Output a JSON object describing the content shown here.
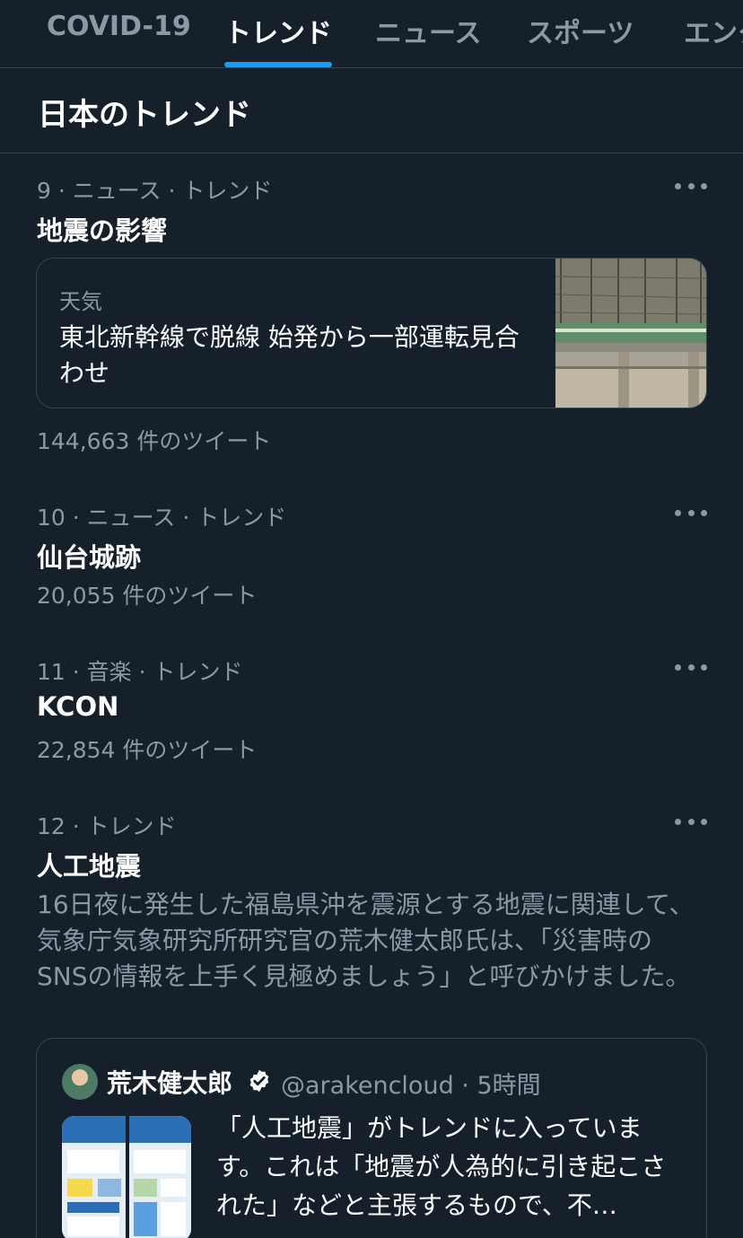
{
  "tabs": [
    {
      "label": "COVID-19",
      "active": false
    },
    {
      "label": "トレンド",
      "active": true
    },
    {
      "label": "ニュース",
      "active": false
    },
    {
      "label": "スポーツ",
      "active": false
    },
    {
      "label": "エンタ",
      "active": false
    }
  ],
  "section_title": "日本のトレンド",
  "trends": [
    {
      "meta": "9 · ニュース · トレンド",
      "topic": "地震の影響",
      "card": {
        "category": "天気",
        "headline": "東北新幹線で脱線 始発から一部運転見合わせ",
        "thumbnail": "bullet-train-on-viaduct-photo"
      },
      "count": "144,663 件のツイート"
    },
    {
      "meta": "10 · ニュース · トレンド",
      "topic": "仙台城跡",
      "count": "20,055 件のツイート"
    },
    {
      "meta": "11 · 音楽 · トレンド",
      "topic": "KCON",
      "count": "22,854 件のツイート"
    },
    {
      "meta": "12 · トレンド",
      "topic": "人工地震",
      "description": "16日夜に発生した福島県沖を震源とする地震に関連して、気象庁気象研究所研究官の荒木健太郎氏は、「災害時のSNSの情報を上手く見極めましょう」と呼びかけました。",
      "tweet": {
        "author": "荒木健太郎",
        "verified": true,
        "handle": "@arakencloud · 5時間",
        "text": "「人工地震」がトレンドに入っています。これは「地震が人為的に引き起こされた」などと主張するもので、不…",
        "thumbnail": "sns-literacy-infographic"
      }
    }
  ],
  "colors": {
    "background": "#15202b",
    "border": "#38444d",
    "secondary_text": "#8b98a5",
    "accent": "#1d9bf0"
  }
}
